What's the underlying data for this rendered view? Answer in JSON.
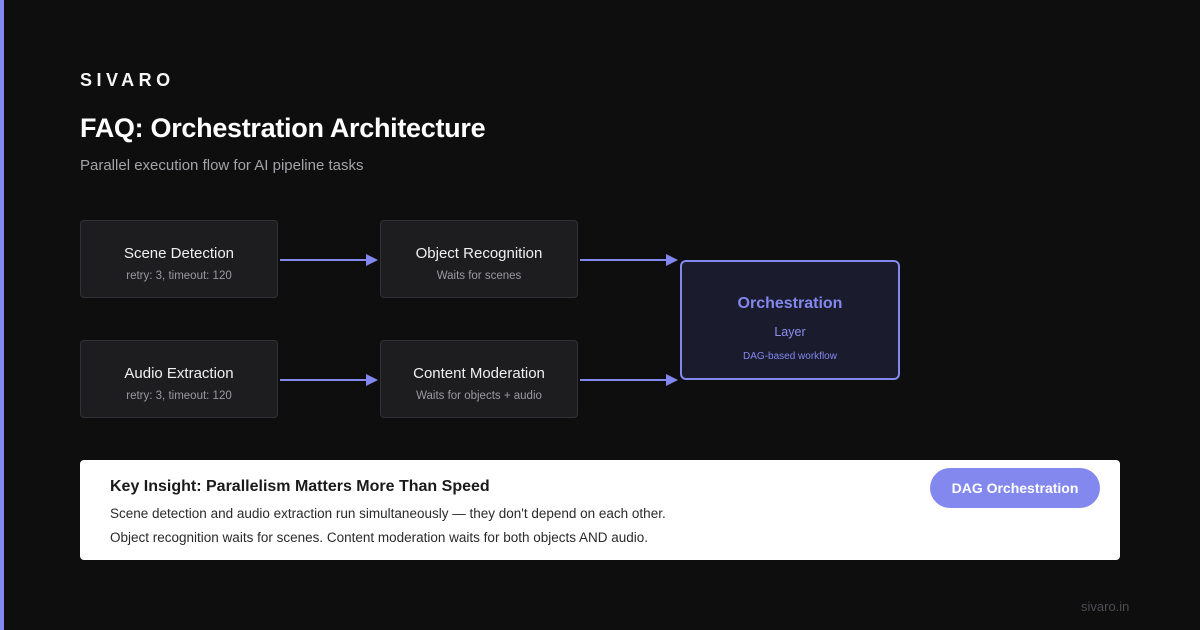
{
  "brand": "SIVARO",
  "title": "FAQ: Orchestration Architecture",
  "subtitle": "Parallel execution flow for AI pipeline tasks",
  "nodes": [
    {
      "title": "Scene Detection",
      "sub": "retry: 3, timeout: 120"
    },
    {
      "title": "Object Recognition",
      "sub": "Waits for scenes"
    },
    {
      "title": "Audio Extraction",
      "sub": "retry: 3, timeout: 120"
    },
    {
      "title": "Content Moderation",
      "sub": "Waits for objects + audio"
    }
  ],
  "orchestration": {
    "title": "Orchestration",
    "subtitle": "Layer",
    "note": "DAG-based workflow"
  },
  "edges": [
    {
      "from": "Scene Detection",
      "to": "Object Recognition"
    },
    {
      "from": "Object Recognition",
      "to": "Orchestration"
    },
    {
      "from": "Audio Extraction",
      "to": "Content Moderation"
    },
    {
      "from": "Content Moderation",
      "to": "Orchestration"
    }
  ],
  "insight": {
    "title": "Key Insight: Parallelism Matters More Than Speed",
    "line1": "Scene detection and audio extraction run simultaneously — they don't depend on each other.",
    "line2": "Object recognition waits for scenes. Content moderation waits for both objects AND audio.",
    "badge": "DAG Orchestration"
  },
  "footer": "sivaro.in",
  "colors": {
    "background": "#0e0e0f",
    "accent": "#8388ee",
    "node_fill": "#1d1d1f",
    "node_border": "#323236",
    "card": "#ffffff"
  }
}
